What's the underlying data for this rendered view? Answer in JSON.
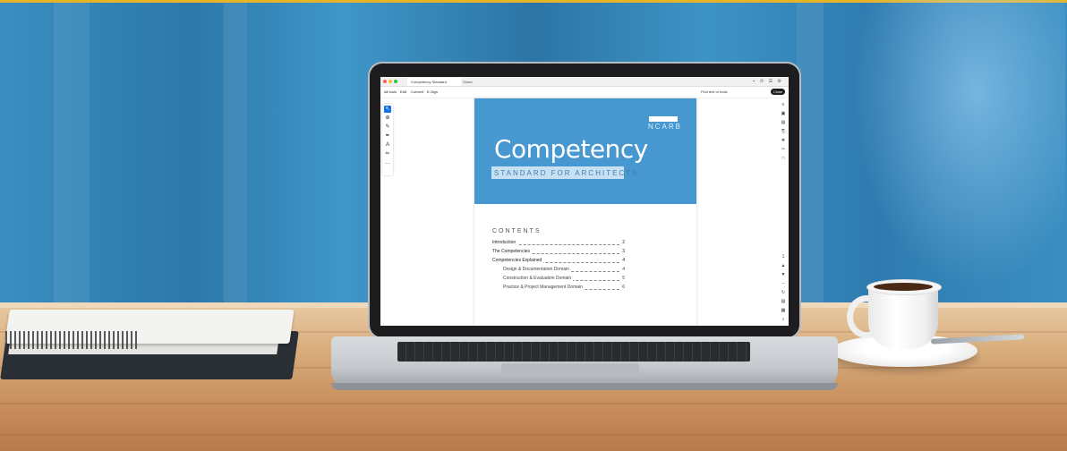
{
  "browser": {
    "tab_title": "Competency Standard",
    "share_label": "Share",
    "toolbar_icons": "⌁ ⟳ ☰ ⚙"
  },
  "toolbar": {
    "menu": [
      "All tools",
      "Edit",
      "Convert",
      "E-Sign"
    ],
    "find_text": "Find text or tools",
    "close_label": "Close"
  },
  "left_tools": [
    "↖",
    "⊕",
    "✎",
    "✒",
    "A",
    "✏",
    "…"
  ],
  "right_tools": [
    "≡",
    "▣",
    "▤",
    "⎘",
    "❖",
    "✂",
    "□"
  ],
  "right_bottom_tools": [
    "1",
    "▲",
    "▼",
    "–",
    "↻",
    "▤",
    "▦",
    "⌕"
  ],
  "document": {
    "brand": "NCARB",
    "title": "Competency",
    "subtitle": "STANDARD FOR ARCHITECTS",
    "contents_heading": "CONTENTS",
    "toc": [
      {
        "label": "Introduction",
        "page": "2",
        "indent": false
      },
      {
        "label": "The Competencies",
        "page": "3",
        "indent": false
      },
      {
        "label": "Competencies Explained",
        "page": "4",
        "indent": false
      },
      {
        "label": "Design & Documentation Domain",
        "page": "4",
        "indent": true
      },
      {
        "label": "Construction & Evaluation Domain",
        "page": "5",
        "indent": true
      },
      {
        "label": "Practice & Project Management Domain",
        "page": "6",
        "indent": true
      }
    ]
  },
  "colors": {
    "cover_blue": "#4797d0",
    "accent_top": "#e7b327",
    "select_blue": "#1473e6"
  }
}
